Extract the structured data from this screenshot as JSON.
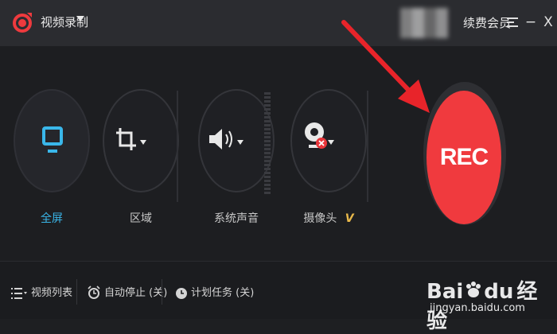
{
  "titlebar": {
    "app_title": "视频录制",
    "renew_label": "续费会员",
    "menu_icon": "menu-icon",
    "minimize_glyph": "−",
    "close_glyph": "X"
  },
  "tools": [
    {
      "label": "全屏",
      "icon": "monitor-icon",
      "active": true
    },
    {
      "label": "区域",
      "icon": "crop-icon",
      "active": false
    },
    {
      "label": "系统声音",
      "icon": "speaker-icon",
      "active": false
    },
    {
      "label": "摄像头",
      "icon": "webcam-icon",
      "active": false,
      "badge": "V"
    }
  ],
  "rec_button": {
    "label": "REC"
  },
  "bottom": {
    "video_list": "视频列表",
    "auto_stop": "自动停止 (关)",
    "schedule": "计划任务 (关)"
  },
  "watermark": {
    "brand": "Bai",
    "brand2": "du",
    "brand3": "经验",
    "url": "jingyan.baidu.com"
  },
  "colors": {
    "accent": "#3ab7ea",
    "rec": "#f03a3e",
    "arrow": "#e8242a",
    "vip_badge": "#e8b84a"
  }
}
